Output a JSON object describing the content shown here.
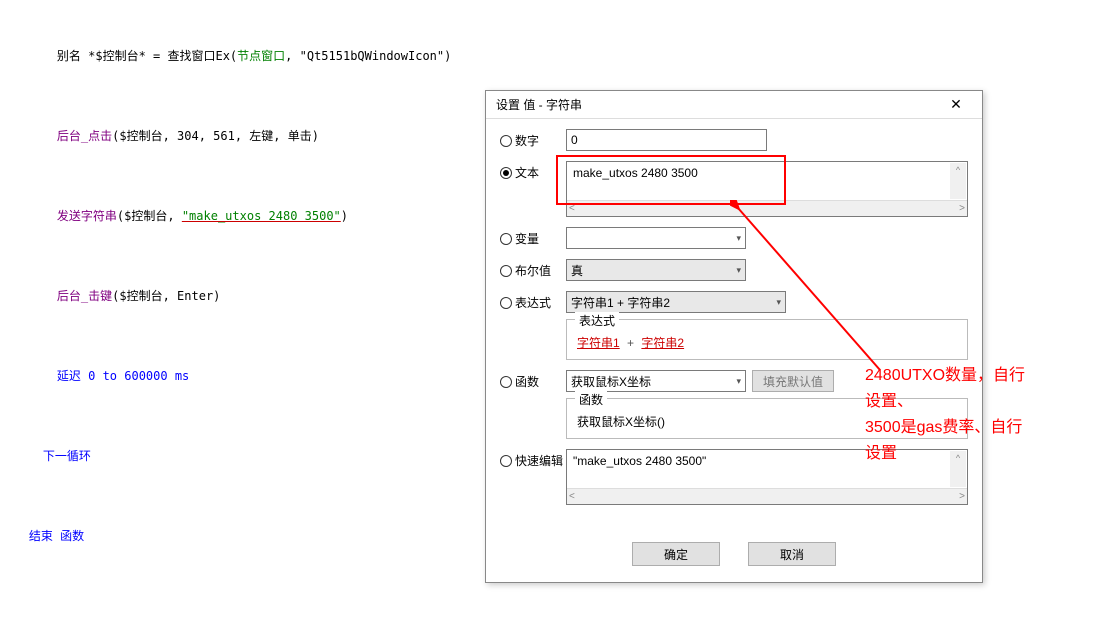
{
  "code": {
    "line1_a": "别名 *$控制台* = 查找窗口Ex(",
    "line1_b": "节点窗口",
    "line1_c": ", \"Qt5151bQWindowIcon\")",
    "line2_a": "后台_点击",
    "line2_b": "($控制台, 304, 561, 左键, 单击)",
    "line3_a": "发送字符串",
    "line3_b": "($控制台, ",
    "line3_c": "\"make_utxos 2480 3500\"",
    "line3_d": ")",
    "line4_a": "后台_击键",
    "line4_b": "($控制台, Enter)",
    "line5": "延迟 0 to 600000 ms",
    "line6": "下一循环",
    "line7": "结束 函数"
  },
  "dialog": {
    "title": "设置 值 - 字符串",
    "close": "✕",
    "labels": {
      "number": "数字",
      "text": "文本",
      "variable": "变量",
      "boolean": "布尔值",
      "expression": "表达式",
      "function": "函数",
      "quickedit": "快速编辑"
    },
    "values": {
      "number": "0",
      "text": "make_utxos 2480 3500",
      "variable": "",
      "boolean": "真",
      "expression": "字符串1 + 字符串2",
      "expr_group": "表达式",
      "expr_link1": "字符串1",
      "expr_link2": "字符串2",
      "function_sel": "获取鼠标X坐标",
      "func_fill": "填充默认值",
      "func_group": "函数",
      "func_body": "获取鼠标X坐标()",
      "quickedit": "\"make_utxos 2480 3500\""
    },
    "buttons": {
      "ok": "确定",
      "cancel": "取消"
    }
  },
  "annotation": {
    "line1": "2480UTXO数量，自行",
    "line2": "设置、",
    "line3": "3500是gas费率、自行",
    "line4": "设置"
  }
}
